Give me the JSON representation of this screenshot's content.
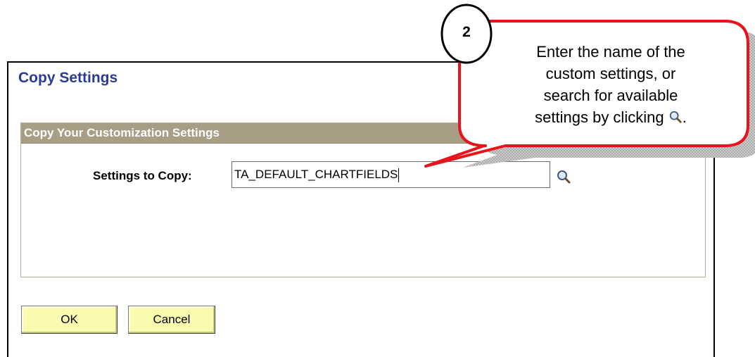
{
  "dialog": {
    "title": "Copy Settings",
    "group_title": "Copy Your Customization Settings",
    "field_label": "Settings to Copy:",
    "field_value": "TA_DEFAULT_CHARTFIELDS",
    "ok_label": "OK",
    "cancel_label": "Cancel"
  },
  "callout": {
    "step_number": "2",
    "line1": "Enter the name of the",
    "line2": "custom settings, or",
    "line3": "search for available",
    "line4_before_icon": "settings by clicking",
    "line4_after_icon": ".",
    "icon": "magnifier-icon"
  },
  "colors": {
    "title": "#2b3a92",
    "group_header_bg": "#a89d85",
    "button_bg": "#fbfbb0",
    "callout_border": "#e8141c"
  }
}
